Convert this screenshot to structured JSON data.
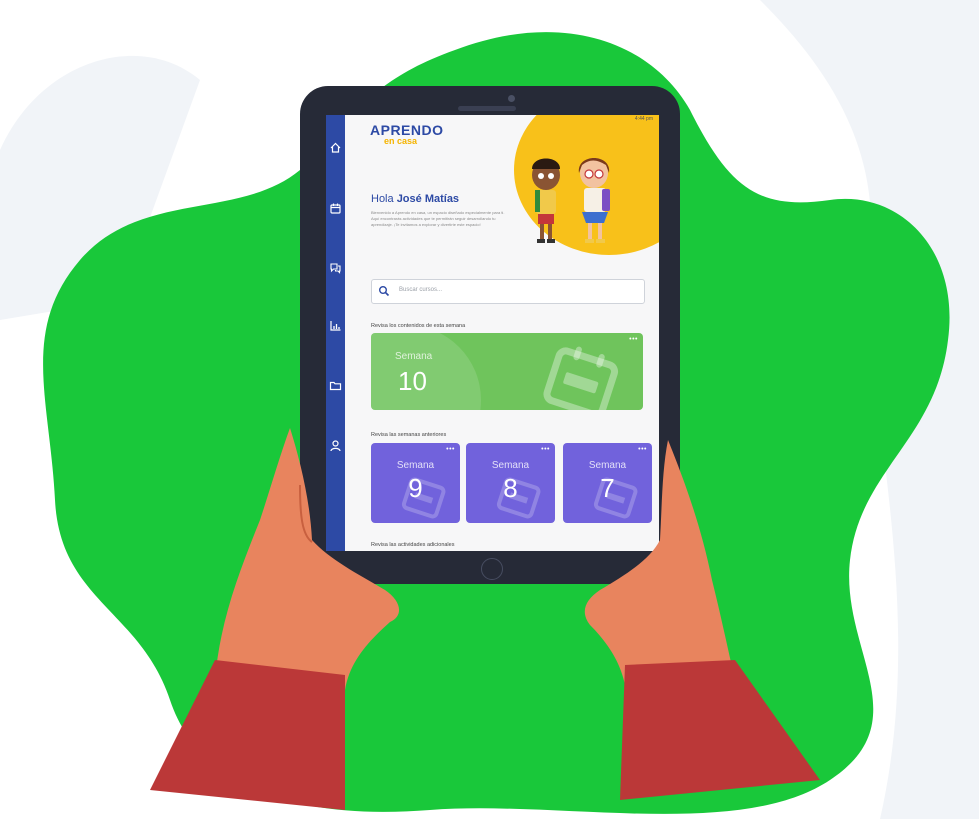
{
  "screen": {
    "status_time": "4:44 pm",
    "logo": {
      "line1": "APRENDO",
      "line2": "en casa",
      "dots": "• • • •"
    },
    "greeting": {
      "prefix": "Hola",
      "name": "José Matías"
    },
    "intro_text": "Bienvenido a Aprendo en casa, un espacio diseñado especialmente para ti. Aquí encontrarás actividades que te permitirán seguir desarrollando tu aprendizaje. ¡Te invitamos a explorar y divertirte este espacio!",
    "search": {
      "placeholder": "Buscar cursos..."
    },
    "current_section_title": "Revisa los contenidos de esta semana",
    "current_week": {
      "label": "Semana",
      "number": "10",
      "menu": "•••"
    },
    "previous_section_title": "Revisa las semanas anteriores",
    "previous_weeks": [
      {
        "label": "Semana",
        "number": "9",
        "menu": "•••"
      },
      {
        "label": "Semana",
        "number": "8",
        "menu": "•••"
      },
      {
        "label": "Semana",
        "number": "7",
        "menu": "•••"
      }
    ],
    "additional_section_title": "Revisa las actividades adicionales",
    "sidebar_icons": [
      "home-icon",
      "calendar-icon",
      "chat-icon",
      "chart-icon",
      "folder-icon",
      "user-icon"
    ]
  },
  "colors": {
    "sidebar": "#2d4aa5",
    "current_week": "#6fc45c",
    "previous_weeks": "#7162dc",
    "accent_yellow": "#f8c11a",
    "background_blob": "#19c83a",
    "tablet_frame": "#262a37",
    "hand": "#e8845e",
    "sleeve": "#bb3838"
  }
}
